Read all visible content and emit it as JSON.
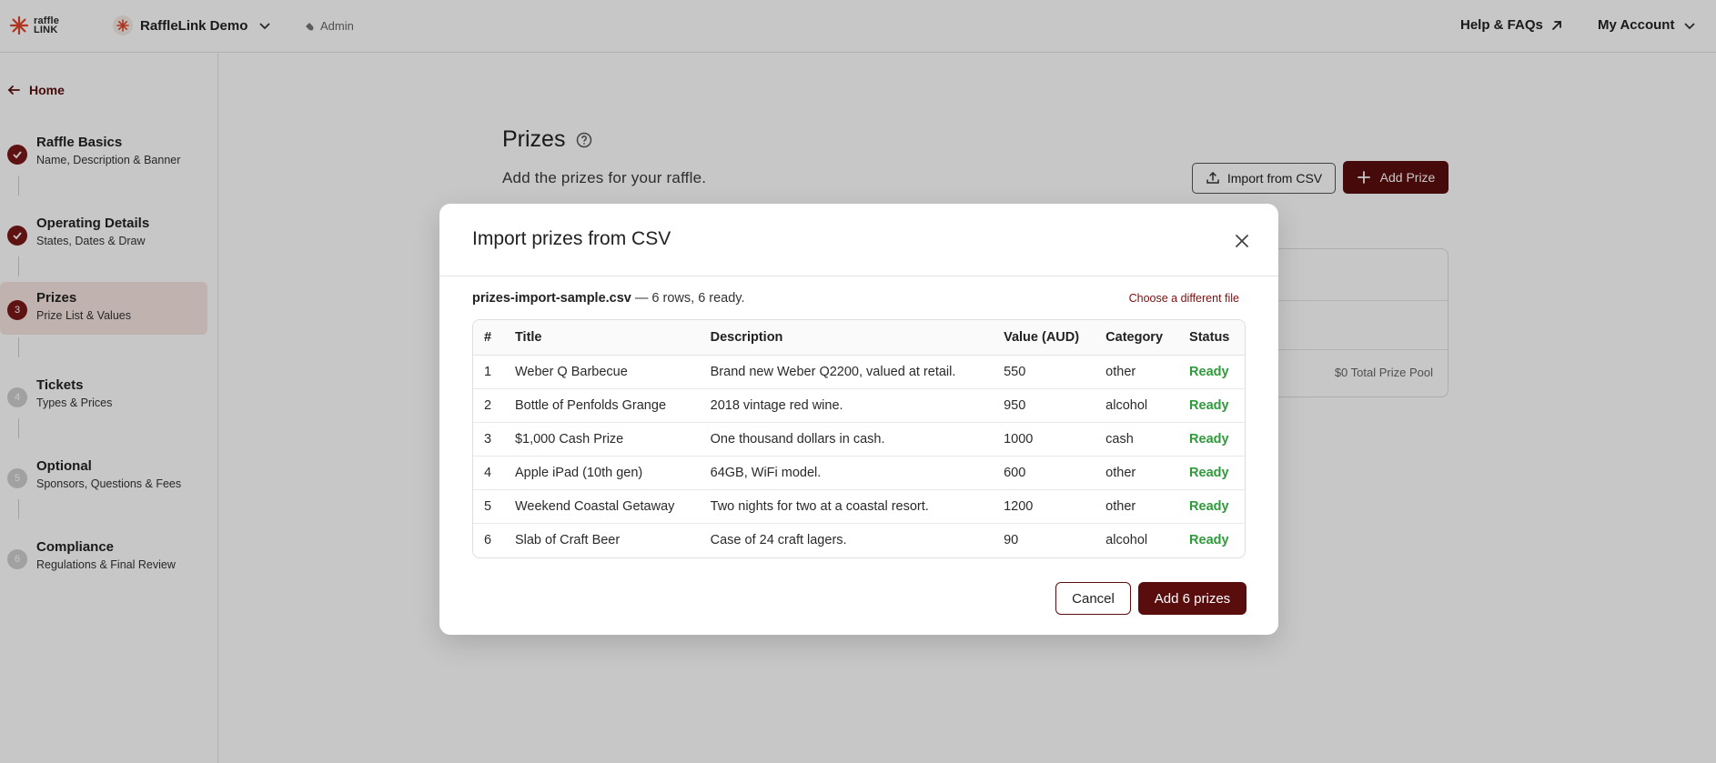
{
  "header": {
    "logo_line1": "raffle",
    "logo_line2": "LINK",
    "org_name": "RaffleLink Demo",
    "admin_label": "Admin",
    "help_label": "Help & FAQs",
    "account_label": "My Account"
  },
  "sidebar": {
    "home_label": "Home",
    "steps": [
      {
        "badge": "",
        "title": "Raffle Basics",
        "subtitle": "Name, Description & Banner",
        "state": "done"
      },
      {
        "badge": "",
        "title": "Operating Details",
        "subtitle": "States, Dates & Draw",
        "state": "done"
      },
      {
        "badge": "3",
        "title": "Prizes",
        "subtitle": "Prize List & Values",
        "state": "current"
      },
      {
        "badge": "4",
        "title": "Tickets",
        "subtitle": "Types & Prices",
        "state": "todo"
      },
      {
        "badge": "5",
        "title": "Optional",
        "subtitle": "Sponsors, Questions & Fees",
        "state": "todo"
      },
      {
        "badge": "6",
        "title": "Compliance",
        "subtitle": "Regulations & Final Review",
        "state": "todo"
      }
    ]
  },
  "main": {
    "title": "Prizes",
    "subtitle": "Add the prizes for your raffle.",
    "import_button": "Import from CSV",
    "add_button": "Add Prize",
    "total_pool": "$0 Total Prize Pool"
  },
  "modal": {
    "title": "Import prizes from CSV",
    "file_name": "prizes-import-sample.csv",
    "file_summary": " — 6 rows, 6 ready.",
    "change_file": "Choose a different file",
    "columns": [
      "#",
      "Title",
      "Description",
      "Value (AUD)",
      "Category",
      "Status"
    ],
    "rows": [
      {
        "num": "1",
        "title": "Weber Q Barbecue",
        "description": "Brand new Weber Q2200, valued at retail.",
        "value": "550",
        "category": "other",
        "status": "Ready"
      },
      {
        "num": "2",
        "title": "Bottle of Penfolds Grange",
        "description": "2018 vintage red wine.",
        "value": "950",
        "category": "alcohol",
        "status": "Ready"
      },
      {
        "num": "3",
        "title": "$1,000 Cash Prize",
        "description": "One thousand dollars in cash.",
        "value": "1000",
        "category": "cash",
        "status": "Ready"
      },
      {
        "num": "4",
        "title": "Apple iPad (10th gen)",
        "description": "64GB, WiFi model.",
        "value": "600",
        "category": "other",
        "status": "Ready"
      },
      {
        "num": "5",
        "title": "Weekend Coastal Getaway",
        "description": "Two nights for two at a coastal resort.",
        "value": "1200",
        "category": "other",
        "status": "Ready"
      },
      {
        "num": "6",
        "title": "Slab of Craft Beer",
        "description": "Case of 24 craft lagers.",
        "value": "90",
        "category": "alcohol",
        "status": "Ready"
      }
    ],
    "cancel_button": "Cancel",
    "confirm_button": "Add 6 prizes"
  },
  "colors": {
    "brand": "#5a0d0d",
    "status_ready": "#2e9a3a",
    "active_step_bg": "#f6e4e1"
  }
}
